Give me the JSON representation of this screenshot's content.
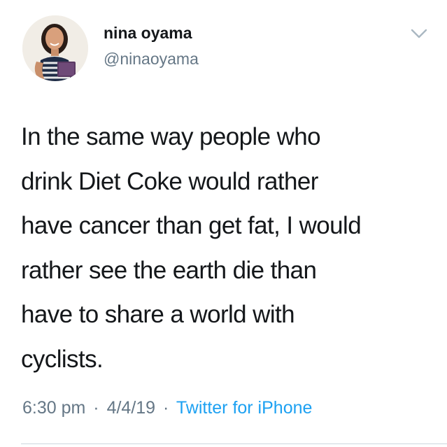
{
  "user": {
    "display_name": "nina oyama",
    "handle": "@ninaoyama",
    "avatar_icon": "profile-photo"
  },
  "tweet": {
    "text_lines": [
      "In the same way people who",
      "drink Diet Coke would rather",
      "have cancer than get fat, I would",
      "rather see the earth die than",
      "have to share a world with",
      "cyclists."
    ]
  },
  "meta": {
    "time": "6:30 pm",
    "separator_1": "·",
    "date": "4/4/19",
    "separator_2": "·",
    "source": "Twitter for iPhone"
  },
  "icons": {
    "menu": "chevron-down-icon"
  },
  "colors": {
    "text": "#14171a",
    "secondary": "#657786",
    "link": "#1da1f2",
    "divider": "#ccd6dd"
  }
}
